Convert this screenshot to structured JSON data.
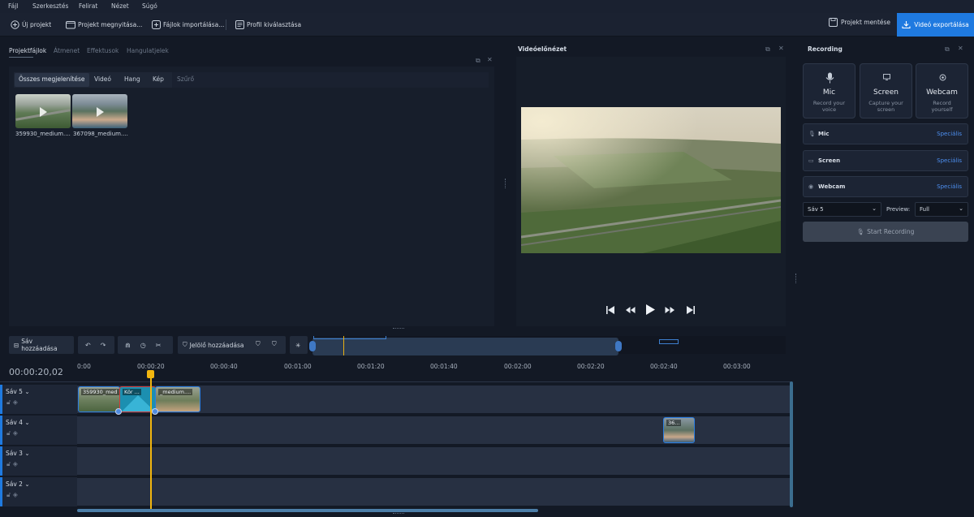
{
  "menu": [
    "Fájl",
    "Szerkesztés",
    "Felirat",
    "Nézet",
    "Súgó"
  ],
  "toolbar": {
    "new_project": "Új projekt",
    "open_project": "Projekt megnyitása...",
    "import_files": "Fájlok importálása...",
    "profile_select": "Profil kiválasztása",
    "save_project": "Projekt mentése",
    "export_video": "Videó exportálása"
  },
  "media": {
    "tabs": [
      "Projektfájlok",
      "Átmenet",
      "Effektusok",
      "Hangulatjelek"
    ],
    "filters": [
      "Összes megjelenítése",
      "Videó",
      "Hang",
      "Kép"
    ],
    "filter_placeholder": "Szűrő",
    "files": [
      "359930_medium....",
      "367098_medium...."
    ]
  },
  "preview": {
    "title": "Videóelőnézet"
  },
  "recording": {
    "title": "Recording",
    "cards": [
      {
        "title": "Mic",
        "sub1": "Record your",
        "sub2": "voice",
        "icon": "mic-icon"
      },
      {
        "title": "Screen",
        "sub1": "Capture your",
        "sub2": "screen",
        "icon": "screen-icon"
      },
      {
        "title": "Webcam",
        "sub1": "Record",
        "sub2": "yourself",
        "icon": "webcam-icon"
      }
    ],
    "rows": [
      {
        "name": "Mic",
        "action": "Speciális"
      },
      {
        "name": "Screen",
        "action": "Speciális"
      },
      {
        "name": "Webcam",
        "action": "Speciális"
      }
    ],
    "track_select": "Sáv 5",
    "preview_label": "Preview:",
    "preview_select": "Full",
    "start_button": "Start Recording"
  },
  "timeline": {
    "add_track": "Sáv hozzáadása",
    "add_marker": "Jelölő hozzáadása",
    "timecode": "00:00:20,02",
    "ruler": [
      "0:00",
      "00:00:20",
      "00:00:40",
      "00:01:00",
      "00:01:20",
      "00:01:40",
      "00:02:00",
      "00:02:20",
      "00:02:40",
      "00:03:00"
    ],
    "tracks": [
      {
        "name": "Sáv 5"
      },
      {
        "name": "Sáv 4"
      },
      {
        "name": "Sáv 3"
      },
      {
        "name": "Sáv 2"
      }
    ],
    "clips": {
      "c1": "359930_med",
      "c2": "Kör ...",
      "c3": "_medium....",
      "c4": "36..."
    }
  },
  "colors": {
    "accent": "#1f7ae0",
    "playhead": "#f2b60f",
    "background": "#131925"
  }
}
